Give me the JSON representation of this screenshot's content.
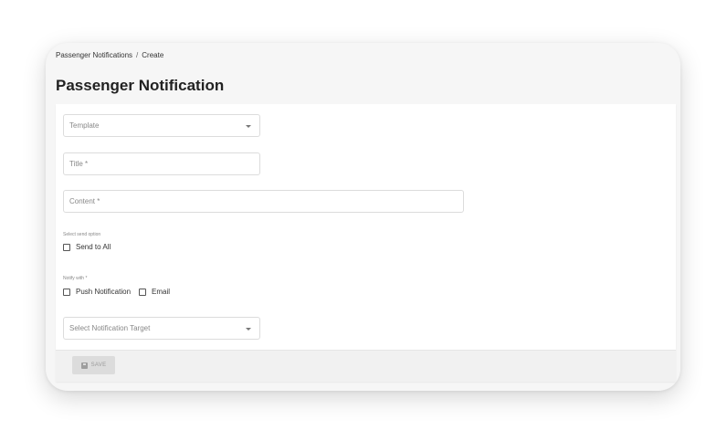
{
  "breadcrumb": {
    "parent": "Passenger Notifications",
    "separator": "/",
    "current": "Create"
  },
  "page": {
    "title": "Passenger Notification"
  },
  "form": {
    "template": {
      "placeholder": "Template"
    },
    "title": {
      "placeholder": "Title *"
    },
    "content": {
      "placeholder": "Content *"
    },
    "send_option": {
      "label": "Select send option",
      "send_to_all": "Send to All"
    },
    "notify_with": {
      "label": "Notify with *",
      "push": "Push Notification",
      "email": "Email"
    },
    "target": {
      "placeholder": "Select Notification Target"
    },
    "save_label": "SAVE"
  }
}
